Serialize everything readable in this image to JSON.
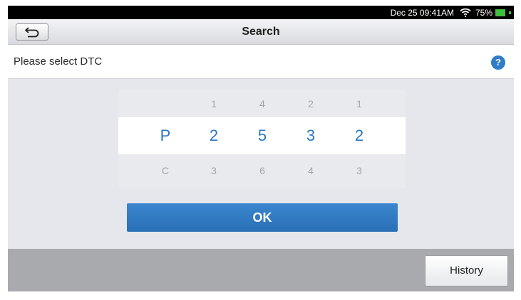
{
  "status_bar": {
    "time": "Dec 25 09:41AM",
    "battery_percent": "75%",
    "battery_level": 0.75,
    "wifi_icon": "wifi-icon",
    "battery_icon": "battery-icon",
    "battery_color": "#3fbf3f"
  },
  "header": {
    "title": "Search",
    "back_icon": "back-arrow-icon"
  },
  "prompt": {
    "text": "Please select DTC",
    "help_label": "?",
    "help_color": "#2f7cc7"
  },
  "picker": {
    "above": [
      "",
      "1",
      "4",
      "2",
      "1"
    ],
    "selected": [
      "P",
      "2",
      "5",
      "3",
      "2"
    ],
    "below": [
      "C",
      "3",
      "6",
      "4",
      "3"
    ],
    "selected_color": "#2a77c4"
  },
  "actions": {
    "ok_label": "OK",
    "history_label": "History"
  }
}
